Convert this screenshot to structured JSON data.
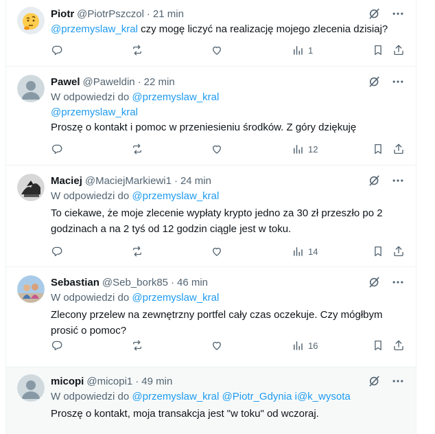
{
  "tweets": [
    {
      "name": "Piotr",
      "handle": "@PiotrPszczol",
      "time": "21 min",
      "reply_prefix": "",
      "reply_to": "",
      "mention": "@przemyslaw_kral",
      "text": " czy mogę liczyć na realizację mojego zlecenia dzisiaj?",
      "views": "1",
      "avatar": "emoji-thinking"
    },
    {
      "name": "Pawel",
      "handle": "@Paweldin",
      "time": "22 min",
      "reply_prefix": "W odpowiedzi do",
      "reply_to": "@przemyslaw_kral",
      "mention": "@przemyslaw_kral",
      "text": "Proszę o kontakt i pomoc w przeniesieniu środków. Z góry dziękuję",
      "views": "12",
      "avatar": "default"
    },
    {
      "name": "Maciej",
      "handle": "@MaciejMarkiewi1",
      "time": "24 min",
      "reply_prefix": "W odpowiedzi do",
      "reply_to": "@przemyslaw_kral",
      "text_line1": "To ciekawe, że moje zlecenie wypłaty krypto jedno za 30 zł przeszło po 2",
      "text_line2": "godzinach a na 2 tyś od 12 godzin ciągle jest w toku.",
      "views": "14",
      "avatar": "photo-dark"
    },
    {
      "name": "Sebastian",
      "handle": "@Seb_bork85",
      "time": "46 min",
      "reply_prefix": "W odpowiedzi do",
      "reply_to": "@przemyslaw_kral",
      "text_line1": "Zlecony przelew na zewnętrzny portfel cały czas oczekuje. Czy mógłbym",
      "text_line2": "prosić o pomoc?",
      "views": "16",
      "avatar": "photo-couple"
    },
    {
      "name": "micopi",
      "handle": "@micopi1",
      "time": "49 min",
      "reply_prefix": "W odpowiedzi do",
      "reply_to": "@przemyslaw_kral",
      "reply_to_2": "@Piotr_Gdynia",
      "reply_to_3": "i@k_wysota",
      "text": "Proszę o kontakt, moja transakcja jest \"w toku\" od wczoraj.",
      "avatar": "default"
    }
  ],
  "icons": [
    "grok-icon",
    "more-icon",
    "reply-icon",
    "repost-icon",
    "like-icon",
    "views-icon",
    "bookmark-icon",
    "share-icon"
  ],
  "colors": {
    "link": "#1d9bf0",
    "muted": "#536471",
    "text": "#0f1419",
    "border": "#eff3f4"
  }
}
